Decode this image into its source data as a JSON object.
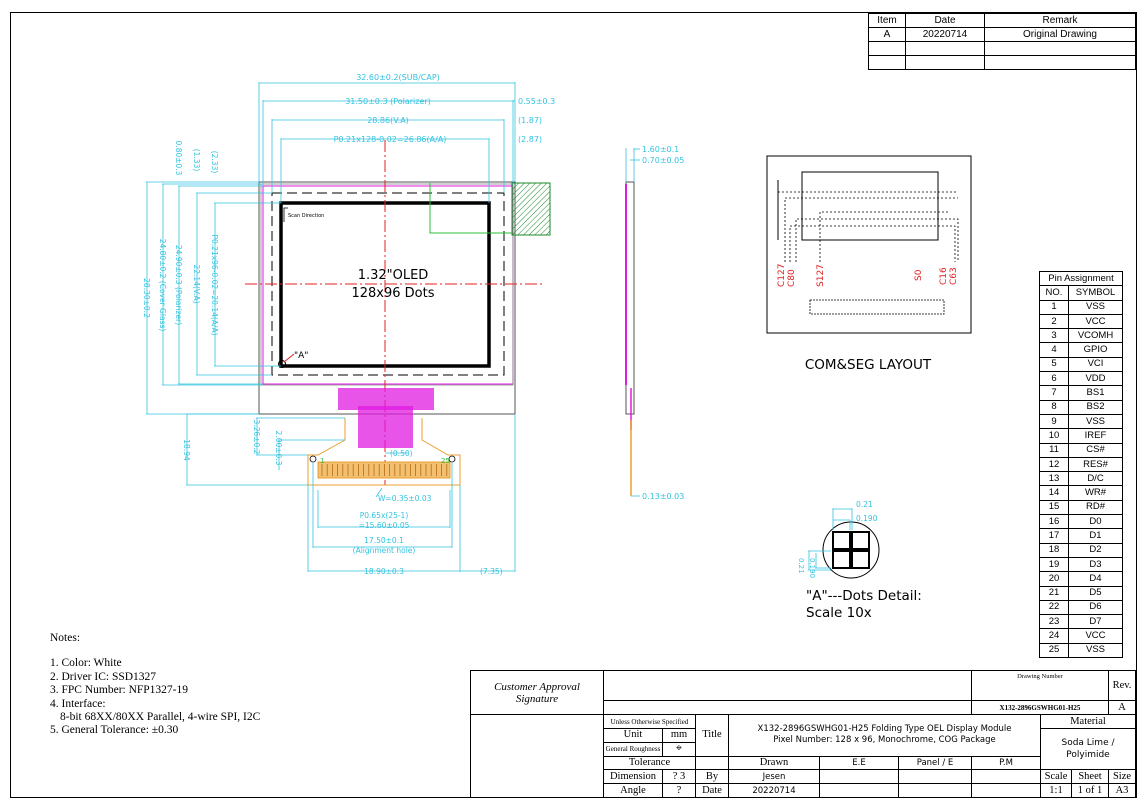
{
  "revision_table": {
    "headers": [
      "Item",
      "Date",
      "Remark"
    ],
    "rows": [
      [
        "A",
        "20220714",
        "Original Drawing"
      ],
      [
        "",
        "",
        ""
      ],
      [
        "",
        "",
        ""
      ]
    ]
  },
  "front_view": {
    "dim_top": [
      "32.60±0.2(SUB/CAP)",
      "31.50±0.3 (Polarizer)",
      "28.86(V.A)",
      "P0.21x128-0.02=26.86(A/A)"
    ],
    "dim_top_right": [
      "0.55±0.3",
      "(1.87)",
      "(2.87)"
    ],
    "dim_left_vertical": [
      "28.30±0.2",
      "24.80±0.2 (Cover Glass)",
      "24.90±0.3 (Polarizer)",
      "22.14(V.A)",
      "P0.21x96-0.02=20.14(A/A)",
      "(1.33)",
      "(2.33)",
      "0.80±0.3"
    ],
    "dim_bottom_left": [
      "18.94",
      "3.26±0.2",
      "2.00±0.3"
    ],
    "center_text": [
      "1.32\"OLED",
      "128x96 Dots"
    ],
    "scan_direction": "Scan Direction",
    "marker_a": "\"A\"",
    "fpc_pin_first": "1",
    "fpc_pin_last": "25",
    "dim_fpc": [
      "(0.50)",
      "W=0.35±0.03",
      "P0.65x(25-1)",
      "=15.60±0.05",
      "17.50±0.1",
      "(Alignment hole)",
      "18.90±0.3",
      "(7.35)"
    ]
  },
  "side_view": {
    "dims": [
      "1.60±0.1",
      "0.70±0.05",
      "0.13±0.03"
    ]
  },
  "com_seg": {
    "labels": [
      "C127",
      "C80",
      "S127",
      "S0",
      "C16",
      "C63"
    ],
    "title": "COM&SEG LAYOUT"
  },
  "dots_detail": {
    "dims": [
      "0.21",
      "0.190",
      "0.21",
      "0.190"
    ],
    "title_line1": "\"A\"---Dots Detail:",
    "title_line2": "Scale 10x"
  },
  "pin_assignment": {
    "title": "Pin Assignment",
    "headers": [
      "NO.",
      "SYMBOL"
    ],
    "pins": [
      [
        "1",
        "VSS"
      ],
      [
        "2",
        "VCC"
      ],
      [
        "3",
        "VCOMH"
      ],
      [
        "4",
        "GPIO"
      ],
      [
        "5",
        "VCI"
      ],
      [
        "6",
        "VDD"
      ],
      [
        "7",
        "BS1"
      ],
      [
        "8",
        "BS2"
      ],
      [
        "9",
        "VSS"
      ],
      [
        "10",
        "IREF"
      ],
      [
        "11",
        "CS#"
      ],
      [
        "12",
        "RES#"
      ],
      [
        "13",
        "D/C"
      ],
      [
        "14",
        "WR#"
      ],
      [
        "15",
        "RD#"
      ],
      [
        "16",
        "D0"
      ],
      [
        "17",
        "D1"
      ],
      [
        "18",
        "D2"
      ],
      [
        "19",
        "D3"
      ],
      [
        "20",
        "D4"
      ],
      [
        "21",
        "D5"
      ],
      [
        "22",
        "D6"
      ],
      [
        "23",
        "D7"
      ],
      [
        "24",
        "VCC"
      ],
      [
        "25",
        "VSS"
      ]
    ]
  },
  "notes": {
    "title": "Notes:",
    "items": [
      "1. Color: White",
      "2. Driver IC: SSD1327",
      "3. FPC Number: NFP1327-19",
      "4. Interface:",
      "8-bit 68XX/80XX Parallel, 4-wire SPI, I2C",
      "5. General Tolerance: ±0.30"
    ]
  },
  "title_block": {
    "customer_approval": "Customer Approval",
    "signature": "Signature",
    "unless": "Unless Otherwise Specified",
    "unit_label": "Unit",
    "unit_value": "mm",
    "roughness": "General Roughness",
    "tolerance": "Tolerance",
    "dimension_label": "Dimension",
    "dimension_value": "? 3",
    "angle_label": "Angle",
    "angle_value": "?",
    "title_label": "Title",
    "title_line1": "X132-2896GSWHG01-H25 Folding Type OEL Display Module",
    "title_line2": "Pixel Number: 128 x 96, Monochrome, COG Package",
    "drawn": "Drawn",
    "ee": "E.E",
    "panel": "Panel / E",
    "pm": "P.M",
    "by_label": "By",
    "by_value": "Jesen",
    "date_label": "Date",
    "date_value": "20220714",
    "drawing_number_label": "Drawing Number",
    "drawing_number": "X132-2896GSWHG01-H25",
    "rev_label": "Rev.",
    "rev_value": "A",
    "material_label": "Material",
    "material_value": "Soda Lime / Polyimide",
    "scale_label": "Scale",
    "scale_value": "1:1",
    "sheet_label": "Sheet",
    "sheet_value": "1 of 1",
    "size_label": "Size",
    "size_value": "A3"
  },
  "colors": {
    "dim_cyan": "#33c3e0",
    "magenta": "#e01ae0",
    "green": "#2bbf3a",
    "red": "#e02020",
    "orange": "#e8a030"
  }
}
